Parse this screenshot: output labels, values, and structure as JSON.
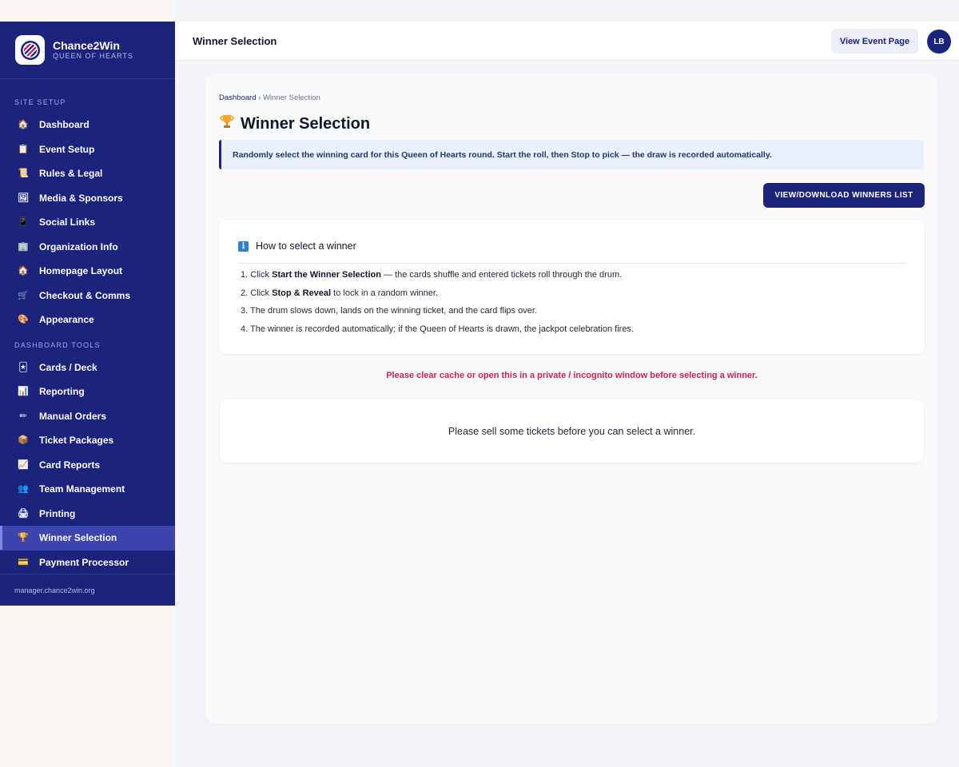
{
  "brand": {
    "name": "Chance2Win",
    "subtitle": "QUEEN OF HEARTS"
  },
  "sidebar": {
    "site_setup_label": "SITE SETUP",
    "site_setup_items": [
      {
        "label": "Dashboard",
        "icon": "house-icon"
      },
      {
        "label": "Event Setup",
        "icon": "clipboard-icon"
      },
      {
        "label": "Rules & Legal",
        "icon": "scroll-icon"
      },
      {
        "label": "Media & Sponsors",
        "icon": "picture-icon"
      },
      {
        "label": "Social Links",
        "icon": "phone-icon"
      },
      {
        "label": "Organization Info",
        "icon": "office-icon"
      },
      {
        "label": "Homepage Layout",
        "icon": "house-icon"
      },
      {
        "label": "Checkout & Comms",
        "icon": "cart-icon"
      },
      {
        "label": "Appearance",
        "icon": "palette-icon"
      }
    ],
    "tools_label": "DASHBOARD TOOLS",
    "tools_items": [
      {
        "label": "Cards / Deck",
        "icon": "joker-card-icon"
      },
      {
        "label": "Reporting",
        "icon": "bar-chart-icon"
      },
      {
        "label": "Manual Orders",
        "icon": "pen-icon"
      },
      {
        "label": "Ticket Packages",
        "icon": "package-icon"
      },
      {
        "label": "Card Reports",
        "icon": "trend-chart-icon"
      },
      {
        "label": "Team Management",
        "icon": "people-icon"
      },
      {
        "label": "Printing",
        "icon": "printer-icon"
      },
      {
        "label": "Winner Selection",
        "icon": "trophy-icon",
        "active": true
      },
      {
        "label": "Payment Processor",
        "icon": "credit-card-icon"
      }
    ],
    "footer": "manager.chance2win.org"
  },
  "topbar": {
    "title": "Winner Selection",
    "view_event_label": "View Event Page",
    "avatar_initials": "LB"
  },
  "main": {
    "breadcrumb_home": "Dashboard",
    "breadcrumb_sep": " › ",
    "breadcrumb_current": "Winner Selection",
    "title": "Winner Selection",
    "info_banner": "Randomly select the winning card for this Queen of Hearts round. Start the roll, then Stop to pick — the draw is recorded automatically.",
    "winners_button": "VIEW/DOWNLOAD WINNERS LIST",
    "howto": {
      "heading": "How to select a winner",
      "steps": [
        {
          "prefix": "1. Click ",
          "bold": "Start the Winner Selection",
          "suffix": " — the cards shuffle and entered tickets roll through the drum."
        },
        {
          "prefix": "2. Click ",
          "bold": "Stop & Reveal",
          "suffix": " to lock in a random winner."
        },
        {
          "prefix": "3. The drum slows down, lands on the winning ticket, and the card flips over.",
          "bold": "",
          "suffix": ""
        },
        {
          "prefix": "4. The winner is recorded automatically; if the Queen of Hearts is drawn, the jackpot celebration fires.",
          "bold": "",
          "suffix": ""
        }
      ]
    },
    "cache_warning": "Please clear cache or open this in a private / incognito window before selecting a winner.",
    "empty_message": "Please sell some tickets before you can select a winner."
  },
  "colors": {
    "sidebar_bg": "#1b237c",
    "accent": "#1b237c",
    "active_item": "#3b45ad",
    "warning": "#d0214b"
  }
}
